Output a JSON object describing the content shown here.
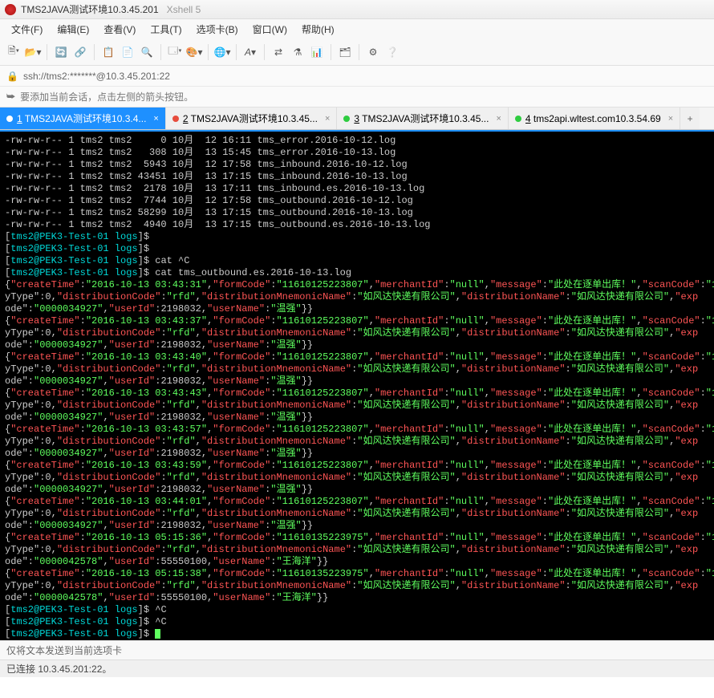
{
  "title": "TMS2JAVA测试环境10.3.45.201",
  "app_subtitle": "Xshell 5",
  "menu": [
    "文件(F)",
    "编辑(E)",
    "查看(V)",
    "工具(T)",
    "选项卡(B)",
    "窗口(W)",
    "帮助(H)"
  ],
  "address": "ssh://tms2:*******@10.3.45.201:22",
  "hint": "要添加当前会话，点击左侧的箭头按钮。",
  "tabs": [
    {
      "num": "1",
      "label": "TMS2JAVA测试环境10.3.4...",
      "status": "active"
    },
    {
      "num": "2",
      "label": "TMS2JAVA测试环境10.3.45...",
      "status": "red"
    },
    {
      "num": "3",
      "label": "TMS2JAVA测试环境10.3.45...",
      "status": "green"
    },
    {
      "num": "4",
      "label": "tms2api.wltest.com10.3.54.69",
      "status": "green"
    }
  ],
  "ls": [
    {
      "perm": "-rw-rw-r--",
      "links": "1",
      "owner": "tms2",
      "group": "tms2",
      "size": "0",
      "mon": "10月",
      "day": "12",
      "time": "16:11",
      "name": "tms_error.2016-10-12.log"
    },
    {
      "perm": "-rw-rw-r--",
      "links": "1",
      "owner": "tms2",
      "group": "tms2",
      "size": "308",
      "mon": "10月",
      "day": "13",
      "time": "15:45",
      "name": "tms_error.2016-10-13.log"
    },
    {
      "perm": "-rw-rw-r--",
      "links": "1",
      "owner": "tms2",
      "group": "tms2",
      "size": "5943",
      "mon": "10月",
      "day": "12",
      "time": "17:58",
      "name": "tms_inbound.2016-10-12.log"
    },
    {
      "perm": "-rw-rw-r--",
      "links": "1",
      "owner": "tms2",
      "group": "tms2",
      "size": "43451",
      "mon": "10月",
      "day": "13",
      "time": "17:15",
      "name": "tms_inbound.2016-10-13.log"
    },
    {
      "perm": "-rw-rw-r--",
      "links": "1",
      "owner": "tms2",
      "group": "tms2",
      "size": "2178",
      "mon": "10月",
      "day": "13",
      "time": "17:11",
      "name": "tms_inbound.es.2016-10-13.log"
    },
    {
      "perm": "-rw-rw-r--",
      "links": "1",
      "owner": "tms2",
      "group": "tms2",
      "size": "7744",
      "mon": "10月",
      "day": "12",
      "time": "17:58",
      "name": "tms_outbound.2016-10-12.log"
    },
    {
      "perm": "-rw-rw-r--",
      "links": "1",
      "owner": "tms2",
      "group": "tms2",
      "size": "58299",
      "mon": "10月",
      "day": "13",
      "time": "17:15",
      "name": "tms_outbound.2016-10-13.log"
    },
    {
      "perm": "-rw-rw-r--",
      "links": "1",
      "owner": "tms2",
      "group": "tms2",
      "size": "4940",
      "mon": "10月",
      "day": "13",
      "time": "17:15",
      "name": "tms_outbound.es.2016-10-13.log"
    }
  ],
  "prompt_host": "tms2@PEK3-Test-01 logs",
  "prompt_lines": [
    "",
    "",
    "cat ^C",
    "cat tms_outbound.es.2016-10-13.log"
  ],
  "json_blocks": [
    {
      "time": "2016-10-13 03:43:31",
      "formCode": "11610125223807",
      "userId": "2198032",
      "userName": "温强",
      "ode": "0000034927"
    },
    {
      "time": "2016-10-13 03:43:37",
      "formCode": "11610125223807",
      "userId": "2198032",
      "userName": "温强",
      "ode": "0000034927"
    },
    {
      "time": "2016-10-13 03:43:40",
      "formCode": "11610125223807",
      "userId": "2198032",
      "userName": "温强",
      "ode": "0000034927"
    },
    {
      "time": "2016-10-13 03:43:43",
      "formCode": "11610125223807",
      "userId": "2198032",
      "userName": "温强",
      "ode": "0000034927"
    },
    {
      "time": "2016-10-13 03:43:57",
      "formCode": "11610125223807",
      "userId": "2198032",
      "userName": "温强",
      "ode": "0000034927"
    },
    {
      "time": "2016-10-13 03:43:59",
      "formCode": "11610125223807",
      "userId": "2198032",
      "userName": "温强",
      "ode": "0000034927"
    },
    {
      "time": "2016-10-13 03:44:01",
      "formCode": "11610125223807",
      "userId": "2198032",
      "userName": "温强",
      "ode": "0000034927"
    },
    {
      "time": "2016-10-13 05:15:36",
      "formCode": "11610135223975",
      "userId": "55550100",
      "userName": "王海洋",
      "ode": "0000042578"
    },
    {
      "time": "2016-10-13 05:15:38",
      "formCode": "11610135223975",
      "userId": "55550100",
      "userName": "王海洋",
      "ode": "0000042578"
    }
  ],
  "json_common": {
    "merchantId": "null",
    "message": "此处在逐单出库！",
    "distributionCode": "rfd",
    "distributionMnemonicName": "如风达快递有限公司",
    "distributionName": "如风达快递有限公司"
  },
  "tail_prompts": [
    "^C",
    "^C",
    ""
  ],
  "bottom_hint": "仅将文本发送到当前选项卡",
  "status": "已连接 10.3.45.201:22。"
}
